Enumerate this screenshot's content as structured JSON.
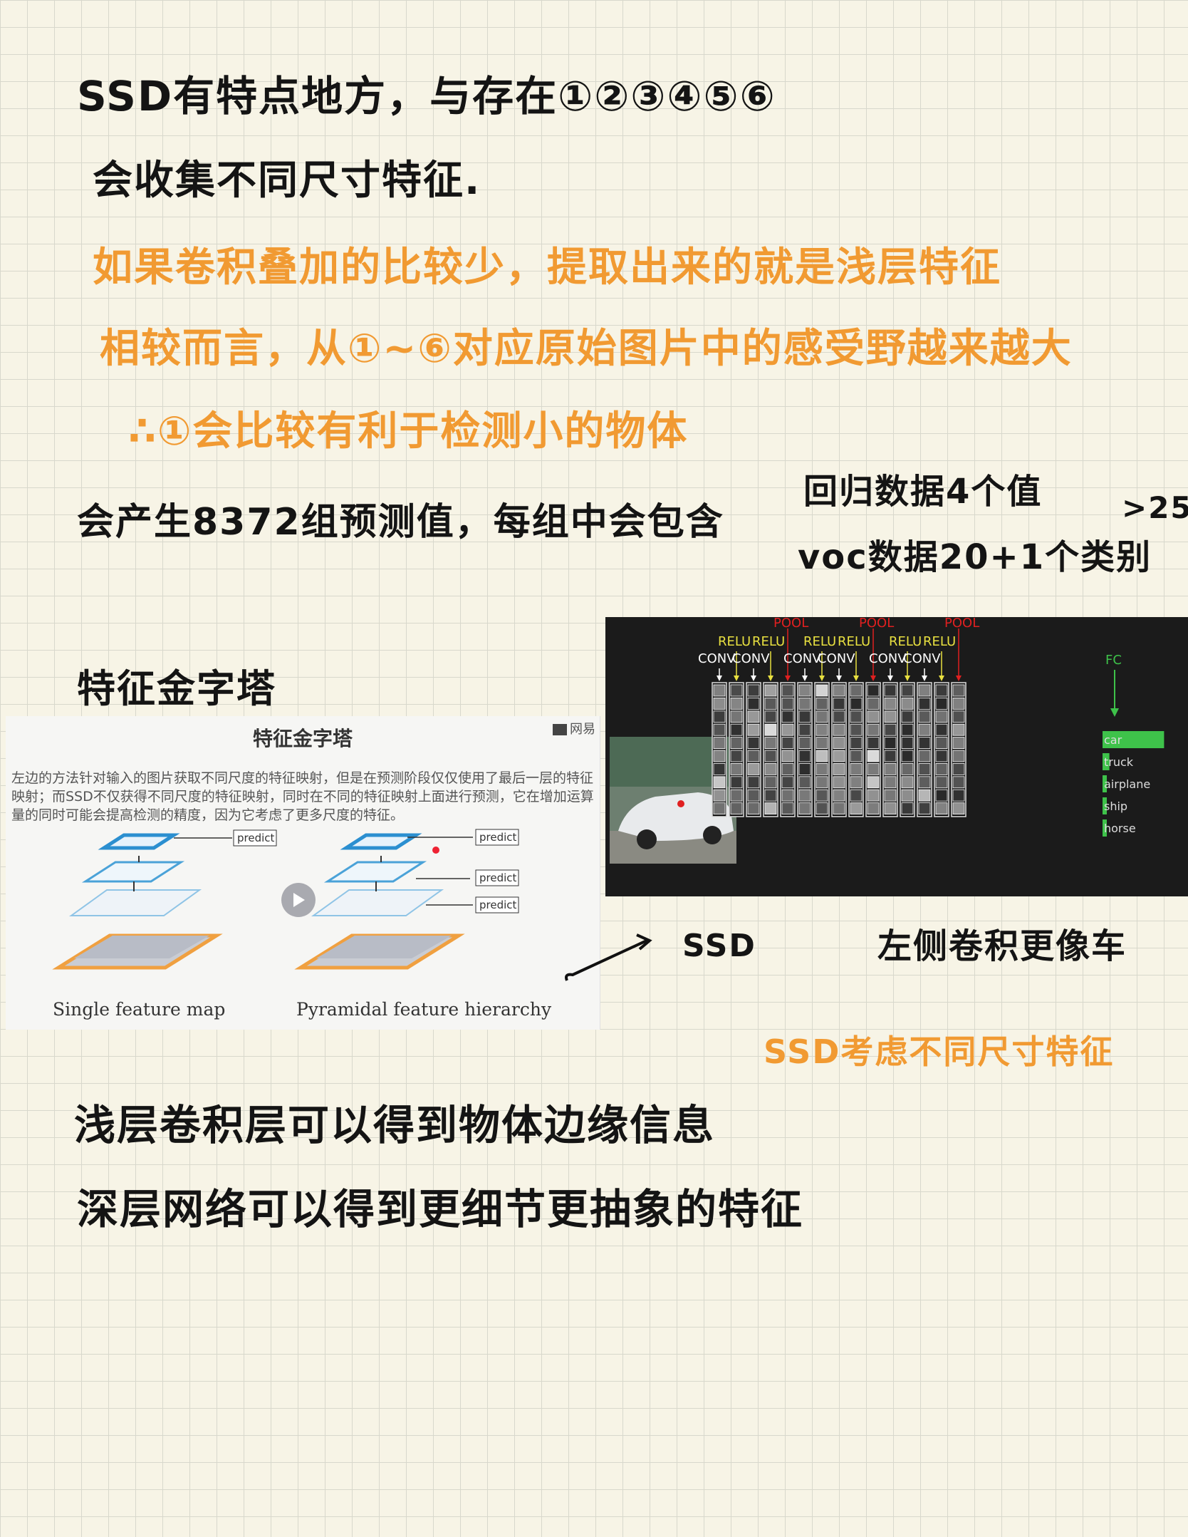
{
  "notes": {
    "line1": "SSD有特点地方，与存在①②③④⑤⑥",
    "line2": "会收集不同尺寸特征.",
    "line3": "如果卷积叠加的比较少，提取出来的就是浅层特征",
    "line4": "相较而言，从①~⑥对应原始图片中的感受野越来越大",
    "line5": "∴①会比较有利于检测小的物体",
    "line6": "会产生8372组预测值，每组中会包含",
    "line7": "回归数据4个值",
    "line8": "voc数据20+1个类别",
    "line9": ">25",
    "line10": "特征金字塔",
    "line11": "SSD",
    "line12": "左侧卷积更像车",
    "line13": "SSD考虑不同尺寸特征",
    "line14": "浅层卷积层可以得到物体边缘信息",
    "line15": "深层网络可以得到更细节更抽象的特征"
  },
  "slide": {
    "title": "特征金字塔",
    "brand": "网易",
    "description": "左边的方法针对输入的图片获取不同尺度的特征映射，但是在预测阶段仅仅使用了最后一层的特征映射；而SSD不仅获得不同尺度的特征映射，同时在不同的特征映射上面进行预测，它在增加运算量的同时可能会提高检测的精度，因为它考虑了更多尺度的特征。",
    "left_caption": "Single feature map",
    "right_caption": "Pyramidal feature hierarchy",
    "predict_label": "predict"
  },
  "cnn": {
    "top_labels": [
      "POOL",
      "POOL",
      "POOL"
    ],
    "relu_label": "RELU",
    "conv_label": "CONV",
    "fc_label": "FC",
    "classes": [
      "car",
      "truck",
      "airplane",
      "ship",
      "horse"
    ],
    "class_scores": [
      0.9,
      0.1,
      0.06,
      0.04,
      0.03
    ],
    "colors": {
      "pool": "#e02020",
      "relu": "#e8e040",
      "conv": "#ffffff",
      "fc": "#3ec24a"
    }
  }
}
